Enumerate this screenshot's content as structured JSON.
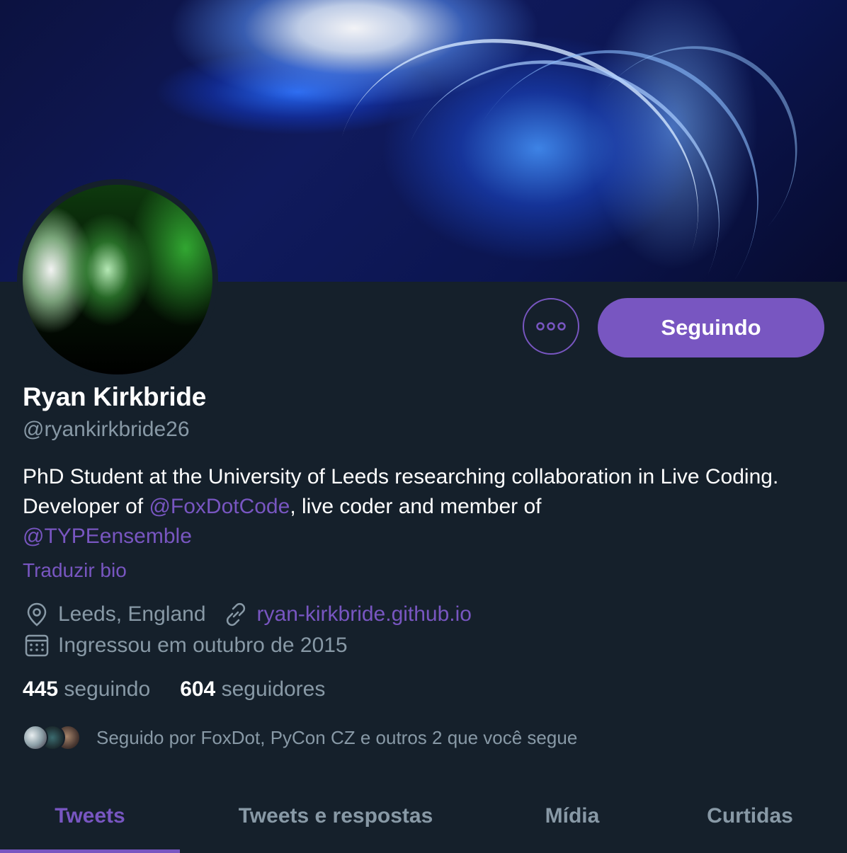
{
  "profile": {
    "name": "Ryan Kirkbride",
    "handle": "@ryankirkbride26",
    "bio": {
      "part1": "PhD Student at the University of Leeds researching collaboration in Live Coding. Developer of ",
      "mention1": "@FoxDotCode",
      "part2": ", live coder and member of ",
      "mention2": "@TYPEensemble"
    },
    "translate_label": "Traduzir bio",
    "location": "Leeds, England",
    "website": "ryan-kirkbride.github.io",
    "joined": "Ingressou em outubro de 2015"
  },
  "actions": {
    "more_icon": "more-horizontal-icon",
    "follow_label": "Seguindo"
  },
  "stats": {
    "following_count": "445",
    "following_label": "seguindo",
    "followers_count": "604",
    "followers_label": "seguidores"
  },
  "followed_by": {
    "text": "Seguido por FoxDot, PyCon CZ e outros 2 que você segue"
  },
  "tabs": [
    {
      "label": "Tweets",
      "active": true
    },
    {
      "label": "Tweets e respostas",
      "active": false
    },
    {
      "label": "Mídia",
      "active": false
    },
    {
      "label": "Curtidas",
      "active": false
    }
  ],
  "colors": {
    "background": "#15202b",
    "accent": "#7856c1",
    "text_primary": "#ffffff",
    "text_secondary": "#8899a6"
  }
}
